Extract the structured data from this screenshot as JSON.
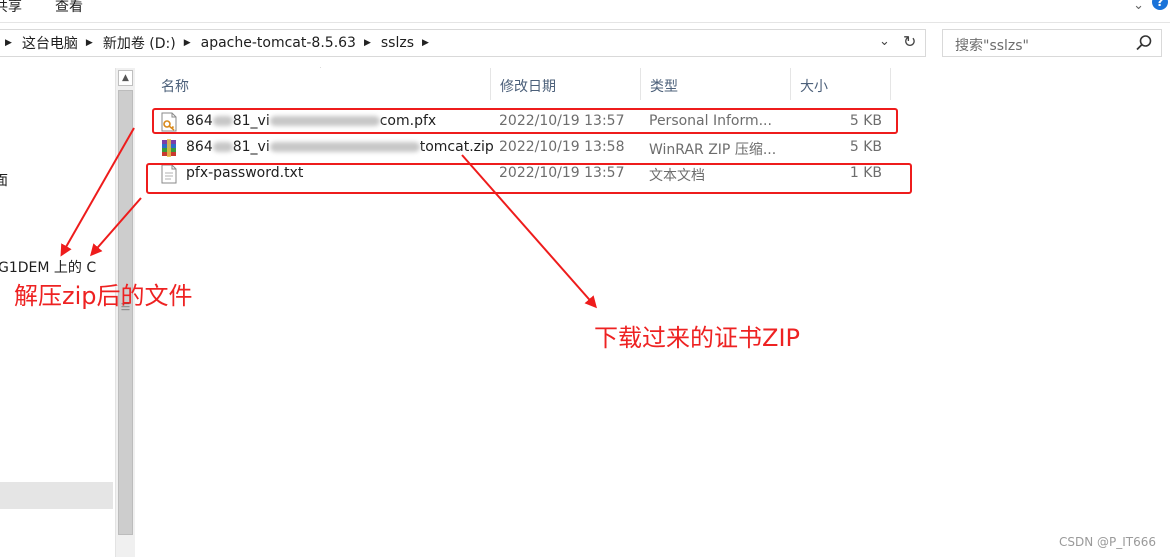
{
  "ribbon": {
    "tabs": [
      "共享",
      "查看"
    ]
  },
  "address_bar": {
    "crumbs": [
      "这台电脑",
      "新加卷 (D:)",
      "apache-tomcat-8.5.63",
      "sslzs"
    ]
  },
  "search": {
    "placeholder": "搜索\"sslzs\""
  },
  "nav_pane": {
    "items": [
      "面",
      "G1DEM 上的 C"
    ]
  },
  "columns": {
    "name": "名称",
    "modified": "修改日期",
    "type": "类型",
    "size": "大小"
  },
  "files": [
    {
      "name_start": "864",
      "name_mid": "81_vi",
      "name_end": "com.pfx",
      "modified": "2022/10/19 13:57",
      "type": "Personal Inform...",
      "size": "5 KB",
      "icon": "pfx-certificate-icon"
    },
    {
      "name_start": "864",
      "name_mid": "81_vi",
      "name_end": "tomcat.zip",
      "modified": "2022/10/19 13:58",
      "type": "WinRAR ZIP 压缩...",
      "size": "5 KB",
      "icon": "winrar-archive-icon"
    },
    {
      "name_start": "pfx-password.txt",
      "name_mid": "",
      "name_end": "",
      "modified": "2022/10/19 13:57",
      "type": "文本文档",
      "size": "1 KB",
      "icon": "text-file-icon"
    }
  ],
  "annotations": {
    "left": "解压zip后的文件",
    "right": "下载过来的证书ZIP",
    "color": "#ee1c1c"
  },
  "watermark": "CSDN @P_IT666"
}
